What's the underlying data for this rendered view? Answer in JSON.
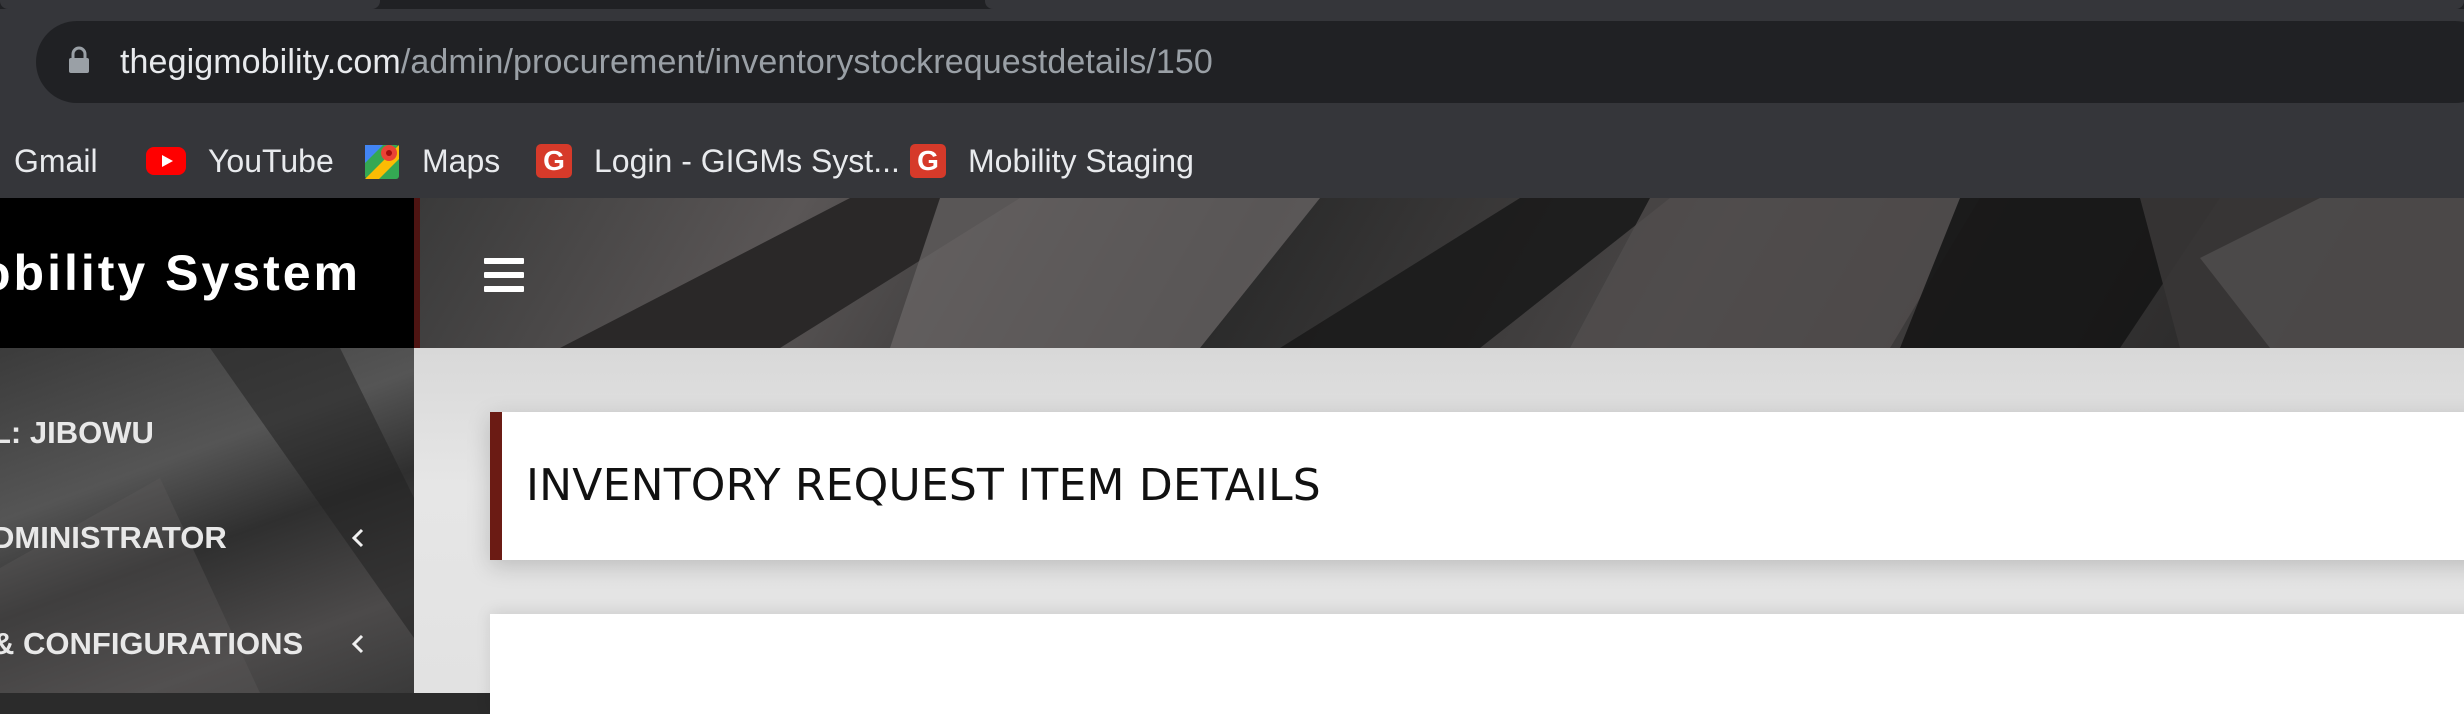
{
  "browser": {
    "url_domain": "thegigmobility.com",
    "url_path": "/admin/procurement/inventorystockrequestdetails/150",
    "bookmarks": [
      {
        "label": "Gmail",
        "icon": "gmail-icon"
      },
      {
        "label": "YouTube",
        "icon": "youtube-icon"
      },
      {
        "label": "Maps",
        "icon": "maps-icon"
      },
      {
        "label": "Login - GIGMs Syst...",
        "icon": "gig-icon"
      },
      {
        "label": "Mobility Staging",
        "icon": "gig-icon"
      }
    ]
  },
  "app": {
    "brand_title": "obility System",
    "menu_icon": "hamburger-icon",
    "sidebar": {
      "items": [
        {
          "label": "L: JIBOWU"
        },
        {
          "label": "DMINISTRATOR",
          "icon": "chevron-left-icon"
        },
        {
          "label": "& CONFIGURATIONS",
          "icon": "chevron-left-icon"
        }
      ]
    },
    "page_title": "INVENTORY REQUEST ITEM DETAILS"
  },
  "colors": {
    "accent": "#6b1b14",
    "brand_border": "#4e1412",
    "chrome_dark": "#202124",
    "chrome": "#35363a"
  }
}
